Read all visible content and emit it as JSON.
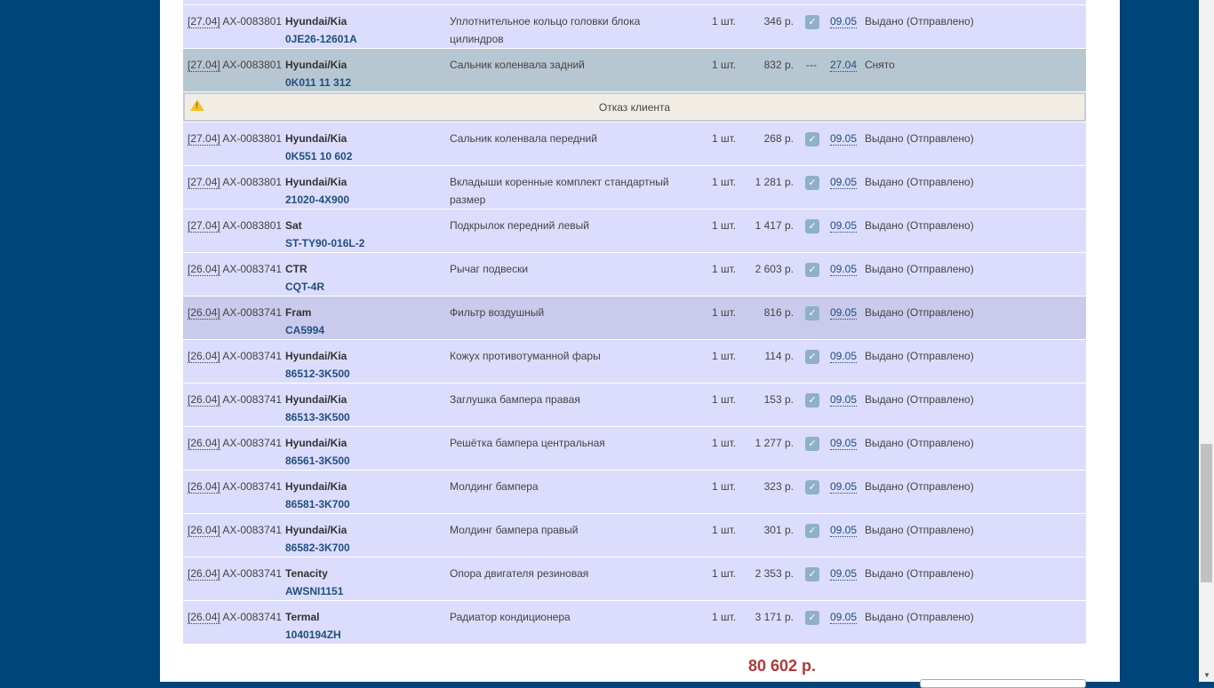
{
  "rows": [
    {
      "date": "[27.04]",
      "order": "AX-0083801",
      "brand": "Hyundai/Kia",
      "article": "0JE26-12601A",
      "desc": "Уплотнительное кольцо головки блока цилиндров",
      "qty": "1 шт.",
      "price": "346 р.",
      "checked": true,
      "sdate": "09.05",
      "status": "Выдано (Отправлено)"
    },
    {
      "date": "[27.04]",
      "order": "AX-0083801",
      "brand": "Hyundai/Kia",
      "article": "0K011 11 312",
      "desc": "Сальник коленвала задний",
      "qty": "1 шт.",
      "price": "832 р.",
      "checked": false,
      "dash": "---",
      "sdate": "27.04",
      "status": "Снято",
      "removed": true
    },
    {
      "date": "[27.04]",
      "order": "AX-0083801",
      "brand": "Hyundai/Kia",
      "article": "0K551 10 602",
      "desc": "Сальник коленвала передний",
      "qty": "1 шт.",
      "price": "268 р.",
      "checked": true,
      "sdate": "09.05",
      "status": "Выдано (Отправлено)"
    },
    {
      "date": "[27.04]",
      "order": "AX-0083801",
      "brand": "Hyundai/Kia",
      "article": "21020-4X900",
      "desc": "Вкладыши коренные комплект стандартный размер",
      "qty": "1 шт.",
      "price": "1 281 р.",
      "checked": true,
      "sdate": "09.05",
      "status": "Выдано (Отправлено)"
    },
    {
      "date": "[27.04]",
      "order": "AX-0083801",
      "brand": "Sat",
      "article": "ST-TY90-016L-2",
      "desc": "Подкрылок передний левый",
      "qty": "1 шт.",
      "price": "1 417 р.",
      "checked": true,
      "sdate": "09.05",
      "status": "Выдано (Отправлено)"
    },
    {
      "date": "[26.04]",
      "order": "AX-0083741",
      "brand": "CTR",
      "article": "CQT-4R",
      "desc": "Рычаг подвески",
      "qty": "1 шт.",
      "price": "2 603 р.",
      "checked": true,
      "sdate": "09.05",
      "status": "Выдано (Отправлено)"
    },
    {
      "date": "[26.04]",
      "order": "AX-0083741",
      "brand": "Fram",
      "article": "CA5994",
      "desc": "Фильтр воздушный",
      "qty": "1 шт.",
      "price": "816 р.",
      "checked": true,
      "sdate": "09.05",
      "status": "Выдано (Отправлено)",
      "highlight": true
    },
    {
      "date": "[26.04]",
      "order": "AX-0083741",
      "brand": "Hyundai/Kia",
      "article": "86512-3K500",
      "desc": "Кожух противотуманной фары",
      "qty": "1 шт.",
      "price": "114 р.",
      "checked": true,
      "sdate": "09.05",
      "status": "Выдано (Отправлено)"
    },
    {
      "date": "[26.04]",
      "order": "AX-0083741",
      "brand": "Hyundai/Kia",
      "article": "86513-3K500",
      "desc": "Заглушка бампера правая",
      "qty": "1 шт.",
      "price": "153 р.",
      "checked": true,
      "sdate": "09.05",
      "status": "Выдано (Отправлено)"
    },
    {
      "date": "[26.04]",
      "order": "AX-0083741",
      "brand": "Hyundai/Kia",
      "article": "86561-3K500",
      "desc": "Решётка бампера центральная",
      "qty": "1 шт.",
      "price": "1 277 р.",
      "checked": true,
      "sdate": "09.05",
      "status": "Выдано (Отправлено)"
    },
    {
      "date": "[26.04]",
      "order": "AX-0083741",
      "brand": "Hyundai/Kia",
      "article": "86581-3K700",
      "desc": "Молдинг бампера",
      "qty": "1 шт.",
      "price": "323 р.",
      "checked": true,
      "sdate": "09.05",
      "status": "Выдано (Отправлено)"
    },
    {
      "date": "[26.04]",
      "order": "AX-0083741",
      "brand": "Hyundai/Kia",
      "article": "86582-3K700",
      "desc": "Молдинг бампера правый",
      "qty": "1 шт.",
      "price": "301 р.",
      "checked": true,
      "sdate": "09.05",
      "status": "Выдано (Отправлено)"
    },
    {
      "date": "[26.04]",
      "order": "AX-0083741",
      "brand": "Tenacity",
      "article": "AWSNI1151",
      "desc": "Опора двигателя резиновая",
      "qty": "1 шт.",
      "price": "2 353 р.",
      "checked": true,
      "sdate": "09.05",
      "status": "Выдано (Отправлено)"
    },
    {
      "date": "[26.04]",
      "order": "AX-0083741",
      "brand": "Termal",
      "article": "1040194ZH",
      "desc": "Радиатор кондиционера",
      "qty": "1 шт.",
      "price": "3 171 р.",
      "checked": true,
      "sdate": "09.05",
      "status": "Выдано (Отправлено)"
    }
  ],
  "warning": {
    "text": "Отказ клиента",
    "after_row": 1
  },
  "total": "80 602 р.",
  "colors": {
    "background": "#00457a",
    "row": "#dcdcfc",
    "removed": "#b7c7d1",
    "total": "#b03a3a"
  }
}
